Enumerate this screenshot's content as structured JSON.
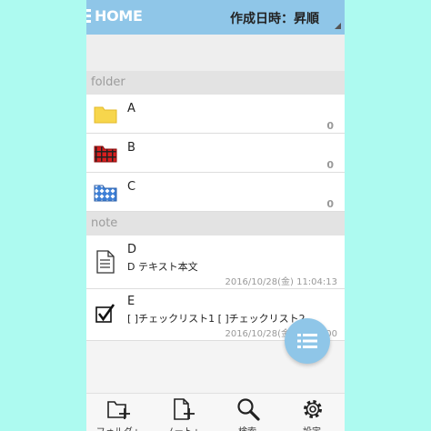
{
  "header": {
    "title": "HOME",
    "sort_label": "作成日時：昇順"
  },
  "sections": {
    "folder": "folder",
    "note": "note"
  },
  "folders": [
    {
      "name": "A",
      "count": "0",
      "icon": "yellow-folder-icon"
    },
    {
      "name": "B",
      "count": "0",
      "icon": "red-plaid-folder-icon"
    },
    {
      "name": "C",
      "count": "0",
      "icon": "blue-diamond-folder-icon"
    }
  ],
  "notes": [
    {
      "name": "D",
      "preview": "D テキスト本文",
      "date": "2016/10/28(金) 11:04:13",
      "icon": "text-document-icon"
    },
    {
      "name": "E",
      "preview": "[  ]チェックリスト1 [  ]チェックリスト2",
      "date": "2016/10/28(金) 11:05:00",
      "icon": "checklist-icon"
    }
  ],
  "toolbar": {
    "add_folder": "フォルダ+",
    "add_note": "ノート+",
    "search": "検索",
    "settings": "設定"
  },
  "colors": {
    "accent": "#8fc6e8",
    "background": "#adfaf0"
  }
}
